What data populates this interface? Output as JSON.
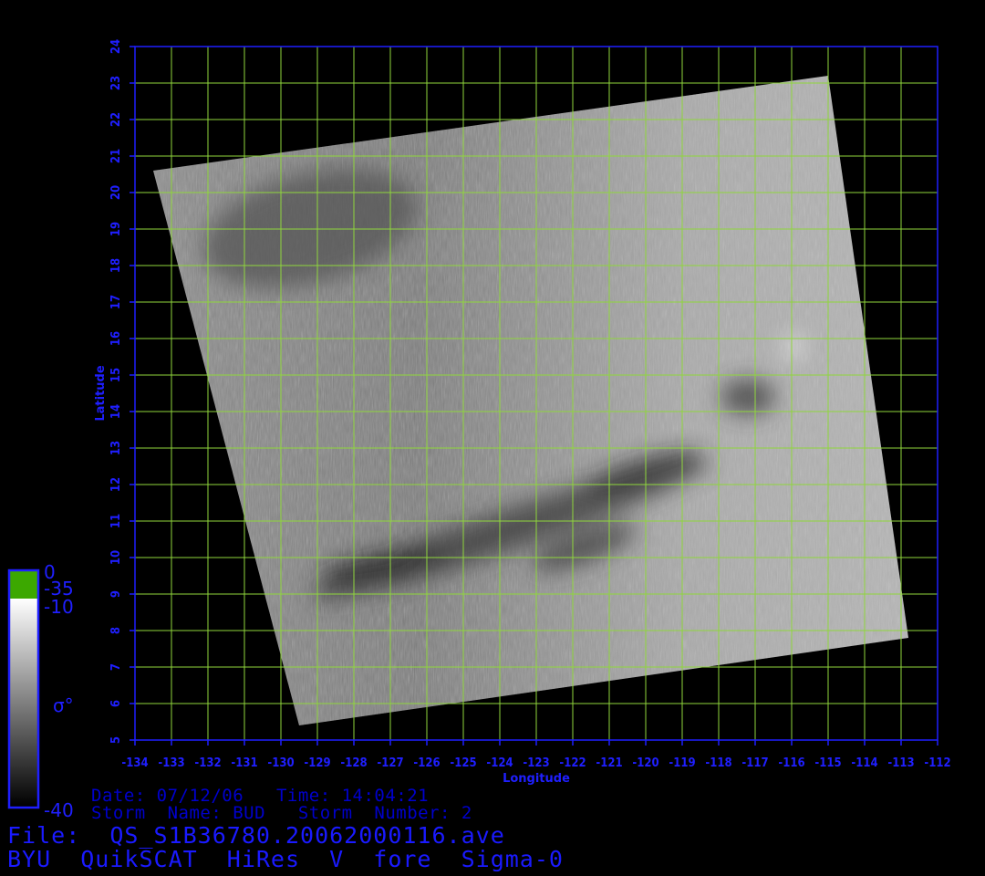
{
  "chart_data": {
    "type": "heatmap",
    "xlabel": "Longitude",
    "ylabel": "Latitude",
    "xlim": [
      -134,
      -112
    ],
    "ylim": [
      5,
      24
    ],
    "x_ticks": [
      "-134",
      "-133",
      "-132",
      "-131",
      "-130",
      "-129",
      "-128",
      "-127",
      "-126",
      "-125",
      "-124",
      "-123",
      "-122",
      "-121",
      "-120",
      "-119",
      "-118",
      "-117",
      "-116",
      "-115",
      "-114",
      "-113",
      "-112"
    ],
    "y_ticks": [
      "5",
      "6",
      "7",
      "8",
      "9",
      "10",
      "11",
      "12",
      "13",
      "14",
      "15",
      "16",
      "17",
      "18",
      "19",
      "20",
      "21",
      "22",
      "23",
      "24"
    ],
    "grid": true,
    "colorbar": {
      "label": "σ°",
      "ticks": [
        "0",
        "-35",
        "-10",
        "-40"
      ],
      "range": [
        -40,
        0
      ]
    },
    "swath_corners_lonlat": [
      [
        -133.5,
        20.6
      ],
      [
        -115.0,
        23.2
      ],
      [
        -112.8,
        7.8
      ],
      [
        -129.5,
        5.4
      ]
    ]
  },
  "info": {
    "date_line": "Date: 07/12/06   Time: 14:04:21",
    "storm_line": "Storm  Name: BUD   Storm  Number: 2"
  },
  "file": {
    "file_line": "File:  QS_S1B36780.20062000116.ave",
    "product_line": "BYU  QuikSCAT  HiRes  V  fore  Sigma-0"
  },
  "colors": {
    "frame": "#1f1fff",
    "grid": "#8fd63c",
    "background": "#000000"
  }
}
